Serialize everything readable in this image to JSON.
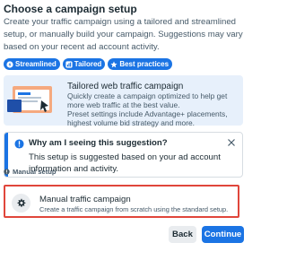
{
  "dialog": {
    "title": "Choose a campaign setup",
    "description": "Create your traffic campaign using a tailored and streamlined setup, or manually build your campaign. Suggestions may vary based on your recent ad account activity."
  },
  "pills": [
    {
      "label": "Streamlined",
      "icon": "bolt-icon"
    },
    {
      "label": "Tailored",
      "icon": "bar-chart-icon"
    },
    {
      "label": "Best practices",
      "icon": "star-icon"
    }
  ],
  "recommended": {
    "title": "Tailored web traffic campaign",
    "text": "Quickly create a campaign optimized to help get more web traffic at the best value.",
    "text2": "Preset settings include Advantage+ placements, highest volume bid strategy and more."
  },
  "why": {
    "title": "Why am I seeing this suggestion?",
    "text": "This setup is suggested based on your ad account information and activity."
  },
  "manual_section": {
    "label": "Manual setup",
    "card_title": "Manual traffic campaign",
    "card_text": "Create a traffic campaign from scratch using the standard setup."
  },
  "footer": {
    "back_label": "Back",
    "continue_label": "Continue"
  },
  "colors": {
    "primary": "#1b74e4",
    "highlight_border": "#e0463b",
    "card_bg": "#e7f0fb"
  }
}
